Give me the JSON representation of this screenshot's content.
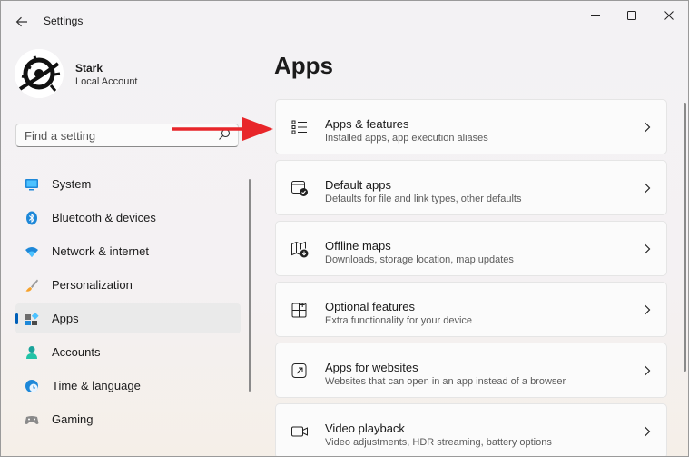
{
  "window": {
    "title": "Settings",
    "back_icon": "arrow-left-icon",
    "controls": [
      "minimize-icon",
      "maximize-icon",
      "close-icon"
    ]
  },
  "account": {
    "name": "Stark",
    "type": "Local Account"
  },
  "search": {
    "placeholder": "Find a setting",
    "value": ""
  },
  "sidebar": {
    "items": [
      {
        "label": "System",
        "icon": "monitor-icon"
      },
      {
        "label": "Bluetooth & devices",
        "icon": "bluetooth-icon"
      },
      {
        "label": "Network & internet",
        "icon": "wifi-icon"
      },
      {
        "label": "Personalization",
        "icon": "brush-icon"
      },
      {
        "label": "Apps",
        "icon": "apps-icon",
        "selected": true
      },
      {
        "label": "Accounts",
        "icon": "person-icon"
      },
      {
        "label": "Time & language",
        "icon": "globe-clock-icon"
      },
      {
        "label": "Gaming",
        "icon": "gamepad-icon"
      }
    ]
  },
  "main": {
    "title": "Apps",
    "cards": [
      {
        "title": "Apps & features",
        "subtitle": "Installed apps, app execution aliases",
        "icon": "list-icon"
      },
      {
        "title": "Default apps",
        "subtitle": "Defaults for file and link types, other defaults",
        "icon": "default-apps-icon"
      },
      {
        "title": "Offline maps",
        "subtitle": "Downloads, storage location, map updates",
        "icon": "map-download-icon"
      },
      {
        "title": "Optional features",
        "subtitle": "Extra functionality for your device",
        "icon": "grid-plus-icon"
      },
      {
        "title": "Apps for websites",
        "subtitle": "Websites that can open in an app instead of a browser",
        "icon": "open-in-app-icon"
      },
      {
        "title": "Video playback",
        "subtitle": "Video adjustments, HDR streaming, battery options",
        "icon": "video-icon"
      }
    ]
  },
  "colors": {
    "accent": "#005fb8",
    "annotation_arrow": "#e8262a"
  }
}
